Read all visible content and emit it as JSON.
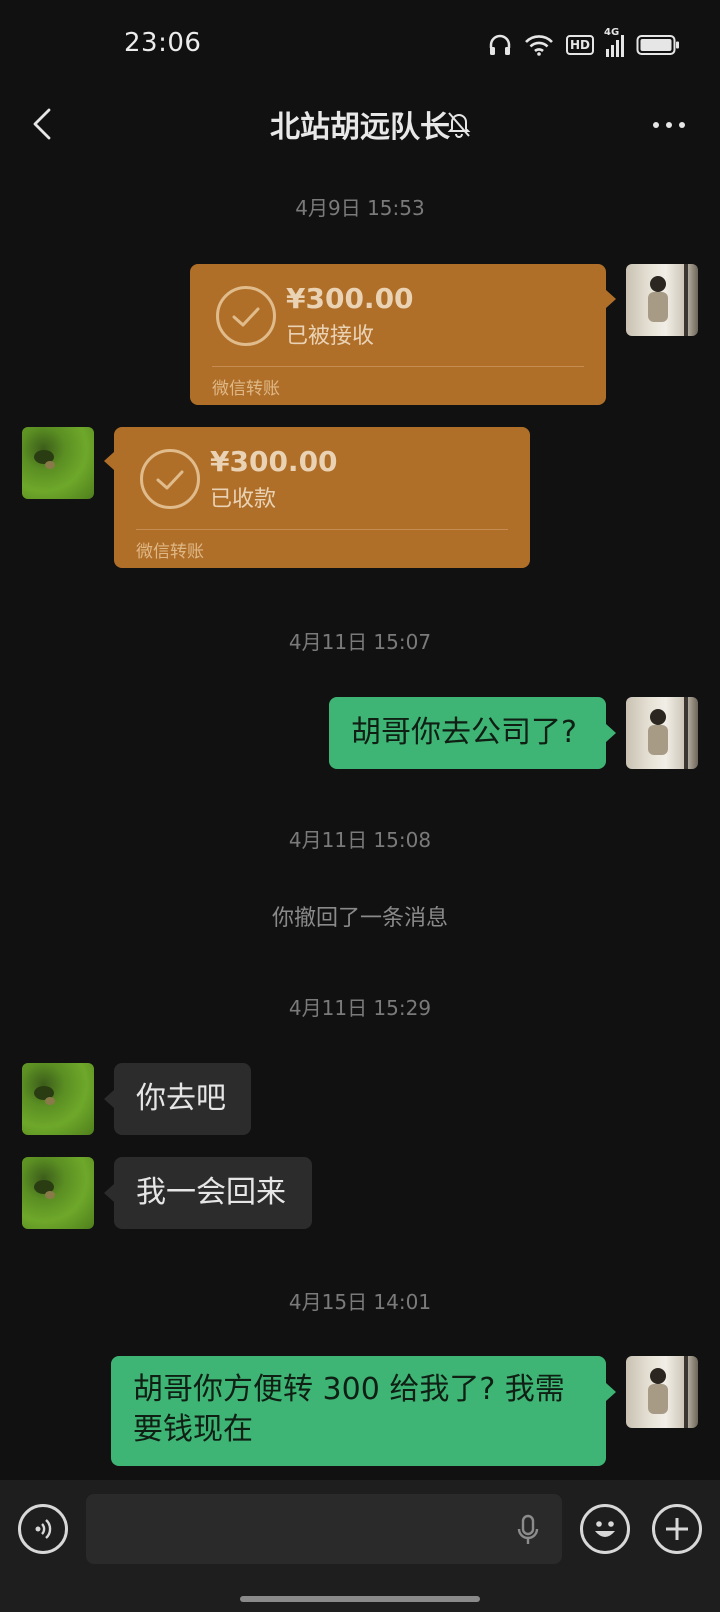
{
  "status": {
    "time": "23:06",
    "network_label": "4G",
    "hd_label": "HD"
  },
  "nav": {
    "title": "北站胡远队长",
    "back_icon": "chevron-left-icon",
    "mute_icon": "bell-off-icon",
    "more_icon": "more-icon"
  },
  "messages": {
    "ts1": "4月9日 15:53",
    "transfer1": {
      "amount": "¥300.00",
      "status": "已被接收",
      "label": "微信转账"
    },
    "transfer2": {
      "amount": "¥300.00",
      "status": "已收款",
      "label": "微信转账"
    },
    "ts2": "4月11日 15:07",
    "msg1": "胡哥你去公司了?",
    "ts3": "4月11日 15:08",
    "recall": "你撤回了一条消息",
    "ts4": "4月11日 15:29",
    "msg2": "你去吧",
    "msg3": "我一会回来",
    "ts5": "4月15日 14:01",
    "msg4": "胡哥你方便转 300 给我了? 我需要钱现在"
  },
  "inputbar": {
    "voice_icon": "voice-icon",
    "mic_icon": "microphone-icon",
    "emoji_icon": "emoji-icon",
    "plus_icon": "plus-icon"
  },
  "colors": {
    "background": "#111111",
    "green_bubble": "#3eb575",
    "gray_bubble": "#2c2c2c",
    "transfer_bubble": "#b06f29"
  }
}
